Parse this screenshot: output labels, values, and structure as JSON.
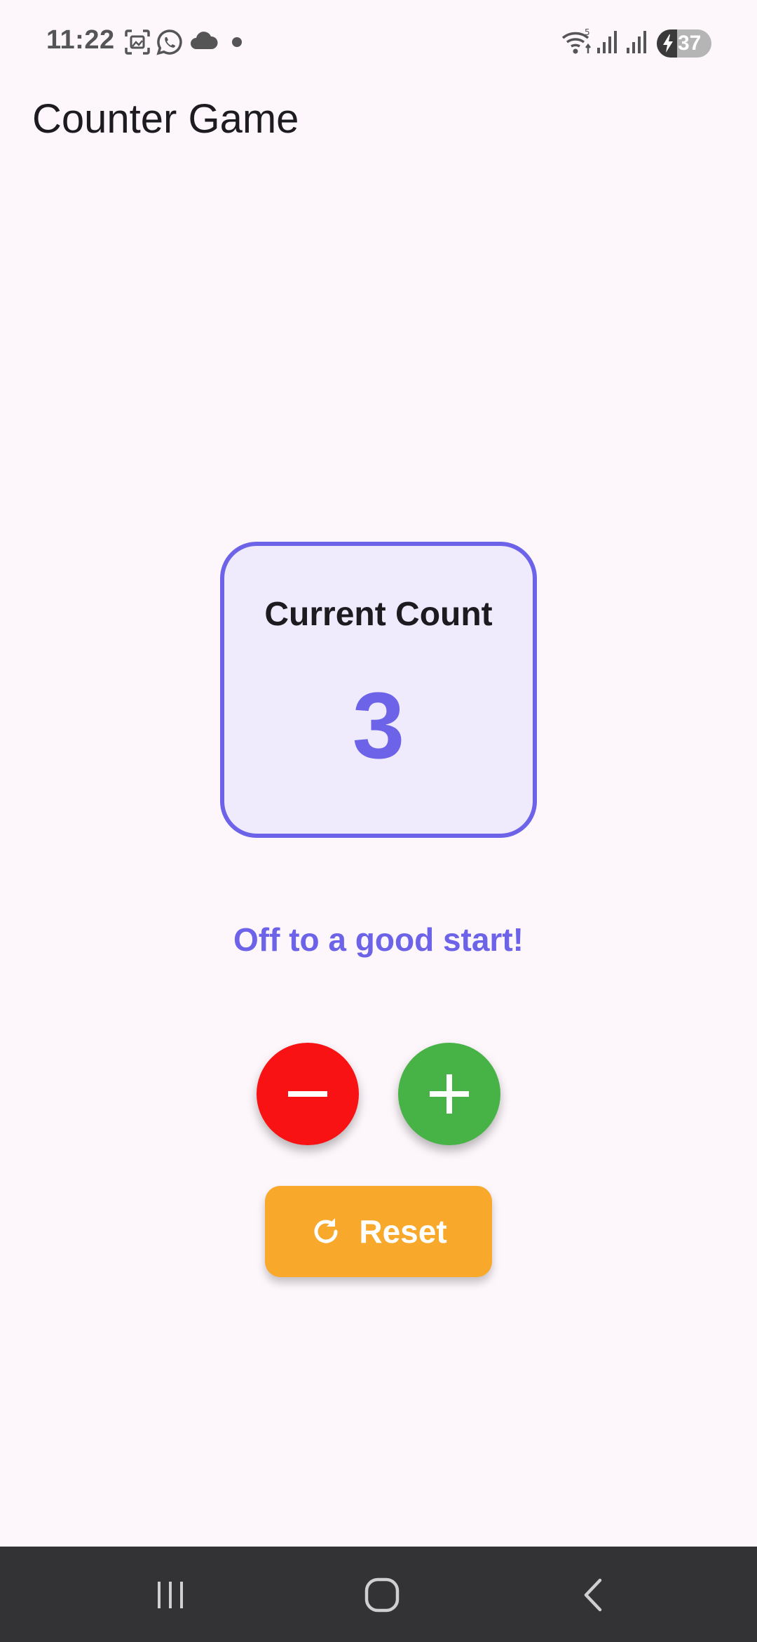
{
  "status_bar": {
    "time": "11:22",
    "battery_level": "37",
    "battery_fraction": 0.37,
    "icons": [
      "screenshot-icon",
      "whatsapp-icon",
      "cloud-icon",
      "notification-dot-icon",
      "wifi-icon",
      "signal-icon",
      "signal-icon",
      "battery-charging-icon"
    ]
  },
  "app_bar": {
    "title": "Counter Game"
  },
  "counter": {
    "label": "Current Count",
    "value": "3"
  },
  "message": "Off to a good start!",
  "controls": {
    "decrement_icon": "minus-icon",
    "increment_icon": "plus-icon",
    "reset_label": "Reset",
    "reset_icon": "refresh-icon"
  },
  "navigation": {
    "items": [
      "recent-apps-icon",
      "home-icon",
      "back-icon"
    ]
  },
  "colors": {
    "accent": "#6C63E8",
    "decrement": "#F81213",
    "increment": "#47B347",
    "reset": "#F8A82A",
    "background": "#FDF7FC",
    "nav_bar": "#333235"
  }
}
